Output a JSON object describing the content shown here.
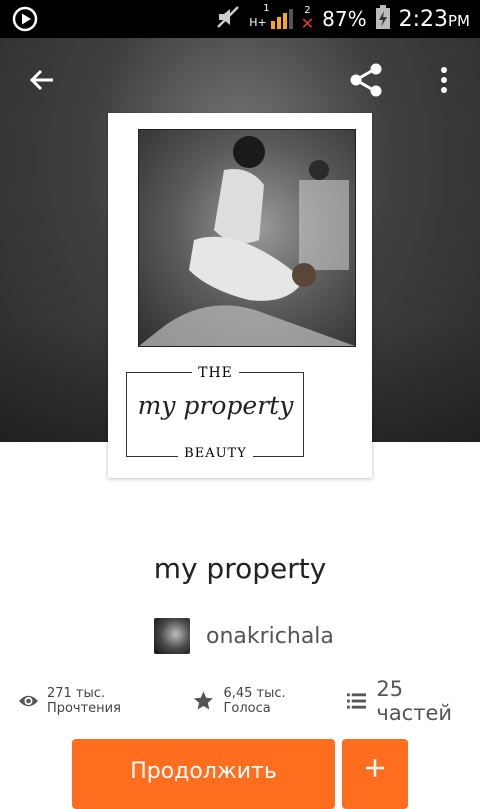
{
  "status_bar": {
    "network_label": "H+",
    "sim1_label": "1",
    "sim2_label": "2",
    "battery": "87%",
    "time": "2:23",
    "ampm": "PM"
  },
  "cover": {
    "the": "THE",
    "script_title": "my property",
    "beauty": "BEAUTY"
  },
  "story": {
    "title": "my property",
    "author": "onakrichala"
  },
  "stats": {
    "reads": "271 тыс. Прочтения",
    "votes": "6,45 тыс. Голоса",
    "parts": "25 частей"
  },
  "actions": {
    "continue_label": "Продолжить",
    "add_label": "+"
  },
  "colors": {
    "accent": "#ff6d1f"
  },
  "icons": [
    "play-icon",
    "mute-icon",
    "signal-icon",
    "battery-icon",
    "back-arrow-icon",
    "share-icon",
    "more-vert-icon",
    "eye-icon",
    "star-icon",
    "list-icon",
    "plus-icon"
  ]
}
